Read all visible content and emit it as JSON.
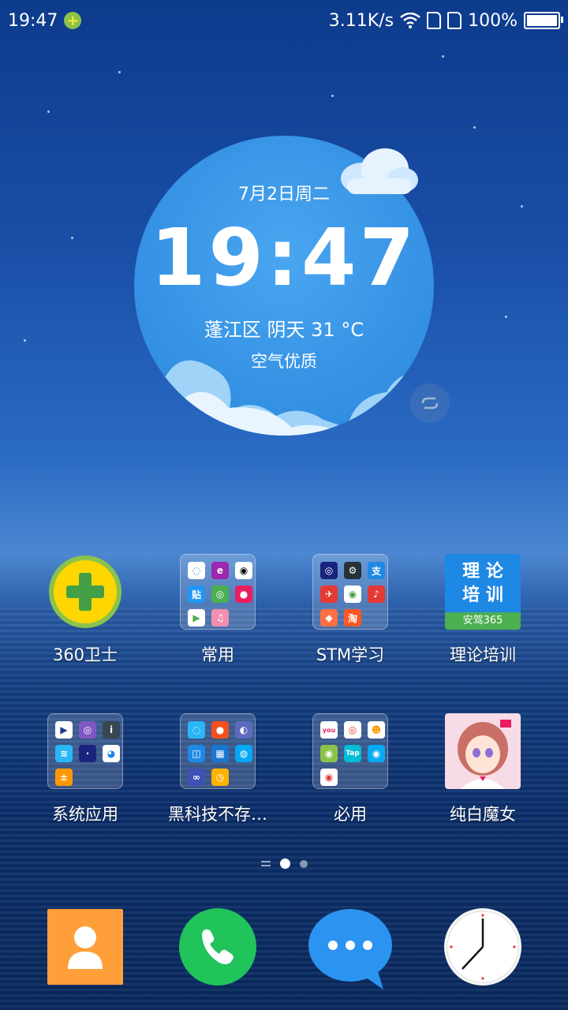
{
  "status_bar": {
    "time": "19:47",
    "net_speed": "3.11K/s",
    "battery": "100%",
    "battery_level": 1.0
  },
  "widget": {
    "date": "7月2日周二",
    "time": "19:47",
    "location_weather": "蓬江区 阴天 31 °C",
    "air_quality": "空气优质"
  },
  "apps": [
    {
      "label": "360卫士"
    },
    {
      "label": "常用"
    },
    {
      "label": "STM学习"
    },
    {
      "label": "理论培训",
      "icon_text_1": "理 论",
      "icon_text_2": "培 训",
      "icon_footer": "安驾365"
    },
    {
      "label": "系统应用"
    },
    {
      "label": "黑科技不存…"
    },
    {
      "label": "必用"
    },
    {
      "label": "纯白魔女"
    }
  ],
  "folder_icons": {
    "common": [
      "贴",
      "e"
    ],
    "stm": [
      "淘"
    ],
    "biyong": [
      "Tap"
    ]
  },
  "page_indicator": {
    "pages": 2,
    "current": 1
  },
  "dock": [
    "contacts-icon",
    "phone-icon",
    "messages-icon",
    "clock-icon"
  ],
  "colors": {
    "widget_blue": "#3592e4",
    "phone_green": "#21c35b",
    "msg_blue": "#2b93f0",
    "contacts_orange": "#ff9f3a"
  }
}
